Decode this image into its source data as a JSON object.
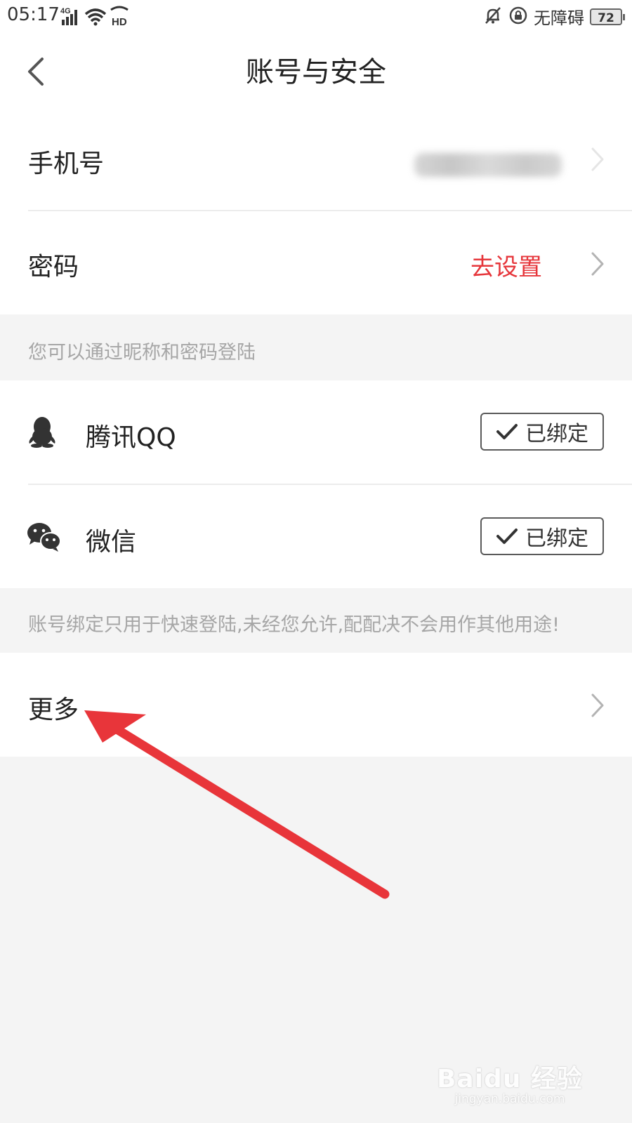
{
  "status_bar": {
    "time": "05:17",
    "network": "4G",
    "hd": "HD",
    "mode": "无障碍",
    "battery": "72",
    "icons": [
      "signal-icon",
      "wifi-icon",
      "hd-icon",
      "mute-bell-icon",
      "rotation-lock-icon",
      "battery-icon"
    ]
  },
  "header": {
    "title": "账号与安全",
    "back_icon": "chevron-left-icon"
  },
  "rows": {
    "phone": {
      "label": "手机号",
      "value_blurred": true
    },
    "password": {
      "label": "密码",
      "action": "去设置"
    },
    "password_hint": "您可以通过昵称和密码登陆",
    "qq": {
      "label": "腾讯QQ",
      "status": "已绑定",
      "icon": "qq-penguin-icon"
    },
    "wechat": {
      "label": "微信",
      "status": "已绑定",
      "icon": "wechat-icon"
    },
    "binding_hint": "账号绑定只用于快速登陆,未经您允许,配配决不会用作其他用途!",
    "more": {
      "label": "更多"
    }
  },
  "colors": {
    "accent_red": "#e6363b",
    "annotation_arrow": "#e8353a",
    "background": "#f4f4f4"
  },
  "watermark": {
    "main": "Baidu 经验",
    "sub": "jingyan.baidu.com"
  }
}
